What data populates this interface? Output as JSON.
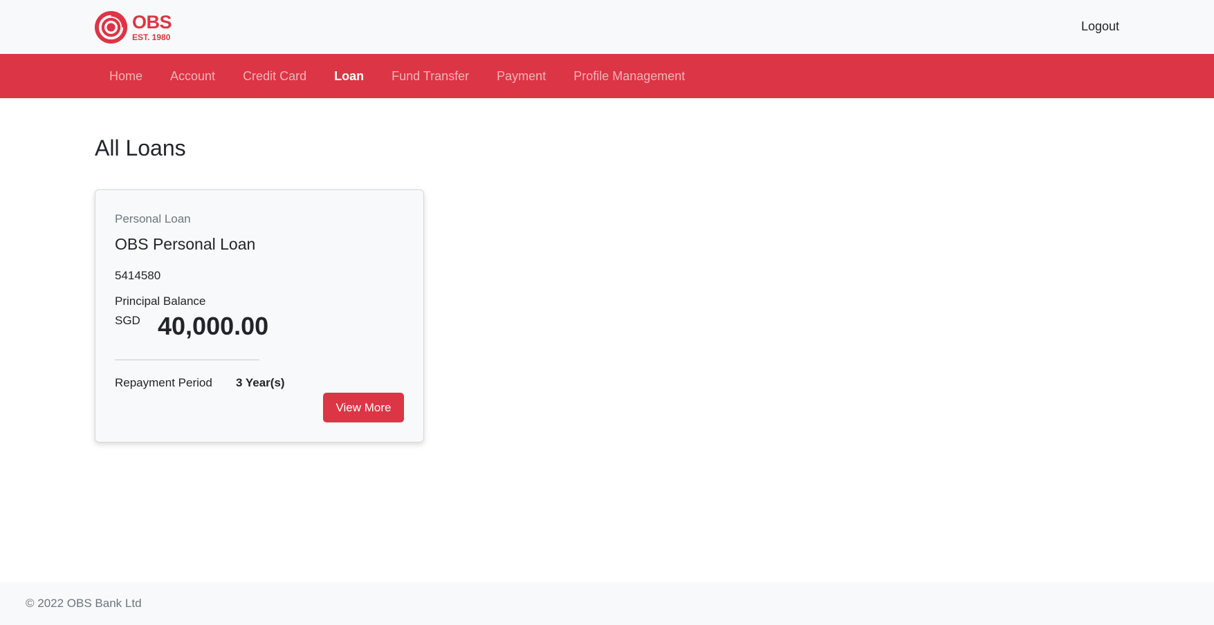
{
  "header": {
    "logo": {
      "name": "OBS",
      "est": "EST. 1980",
      "icon": "obs-ring-logo"
    },
    "logout_label": "Logout"
  },
  "nav": {
    "items": [
      {
        "label": "Home",
        "active": false
      },
      {
        "label": "Account",
        "active": false
      },
      {
        "label": "Credit Card",
        "active": false
      },
      {
        "label": "Loan",
        "active": true
      },
      {
        "label": "Fund Transfer",
        "active": false
      },
      {
        "label": "Payment",
        "active": false
      },
      {
        "label": "Profile Management",
        "active": false
      }
    ]
  },
  "main": {
    "title": "All Loans",
    "loans": [
      {
        "type": "Personal Loan",
        "name": "OBS Personal Loan",
        "account_number": "5414580",
        "balance_label": "Principal Balance",
        "currency": "SGD",
        "balance": "40,000.00",
        "repayment_label": "Repayment Period",
        "repayment_value": "3 Year(s)",
        "button_label": "View More"
      }
    ]
  },
  "footer": {
    "copyright": "© 2022 OBS Bank Ltd"
  },
  "colors": {
    "brand": "#dc3545",
    "header_bg": "#f8f9fa",
    "card_bg": "#f8f9fa"
  }
}
